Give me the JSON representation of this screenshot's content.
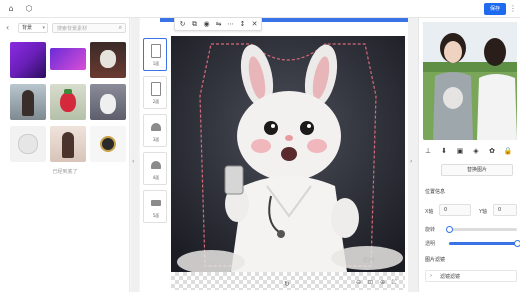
{
  "header": {
    "icons": [
      "home-icon",
      "box-icon"
    ],
    "save_label": "保存",
    "more_icon": "ellipsis-icon"
  },
  "left_panel": {
    "category": "背景",
    "search_placeholder": "搜索背景素材",
    "end_text": "已经到底了"
  },
  "toolbar": {
    "icons": [
      "rotate-icon",
      "copy-icon",
      "layers-icon",
      "flip-icon",
      "more-icon",
      "align-icon",
      "delete-icon"
    ]
  },
  "views": [
    {
      "label": "1面"
    },
    {
      "label": "2面"
    },
    {
      "label": "3面"
    },
    {
      "label": "4面"
    },
    {
      "label": "5面"
    }
  ],
  "canvas": {
    "watermark": "图片",
    "bottom_icons": [
      "zoom-out-icon",
      "fit-icon",
      "zoom-in-icon",
      "fullscreen-icon"
    ]
  },
  "right_panel": {
    "icon_tabs": [
      "stamp-icon",
      "download-icon",
      "crop-icon",
      "filter-icon",
      "adjust-icon",
      "lock-icon"
    ],
    "replace_label": "替换图片",
    "position_title": "位置信息",
    "x_label": "X轴",
    "x_value": "0",
    "y_label": "Y轴",
    "y_value": "0",
    "rotate_label": "旋转",
    "rotate_value": 0.0,
    "opacity_label": "透明",
    "opacity_value": 1.0,
    "filter_title": "图片滤镜",
    "filter_option": "滤镜滤镜"
  },
  "colors": {
    "accent": "#1f6bf0"
  }
}
